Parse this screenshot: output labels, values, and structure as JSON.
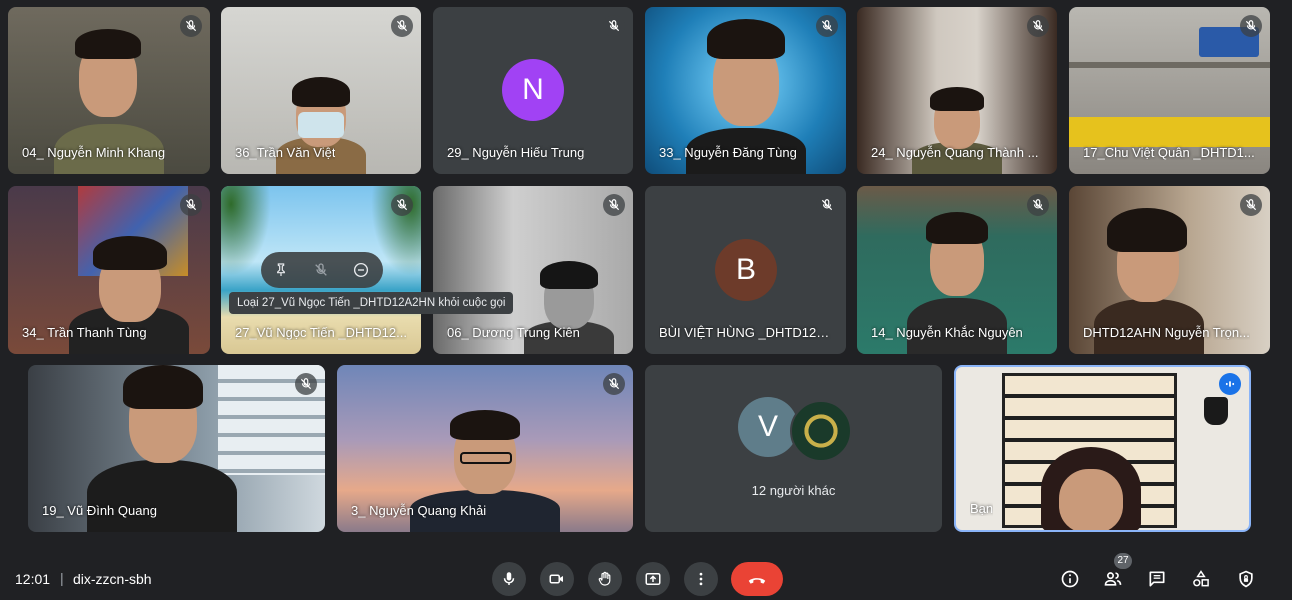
{
  "meeting": {
    "time": "12:01",
    "separator": "|",
    "code": "dix-zzcn-sbh"
  },
  "participants": [
    {
      "name": "04_ Nguyễn Minh Khang"
    },
    {
      "name": "36_Trần Văn Việt"
    },
    {
      "name": "29_ Nguyễn Hiếu Trung",
      "initial": "N",
      "avatar_color": "#a142f4"
    },
    {
      "name": "33_ Nguyễn Đăng Tùng"
    },
    {
      "name": "24_ Nguyễn Quang Thành ..."
    },
    {
      "name": "17_Chu Việt Quân _DHTD1..."
    },
    {
      "name": "34_ Trần Thanh Tùng"
    },
    {
      "name": "27_Vũ Ngọc Tiến _DHTD12..."
    },
    {
      "name": "06_ Dương Trung Kiên"
    },
    {
      "name": "BÙI VIỆT HÙNG _DHTD12A2...",
      "initial": "B",
      "avatar_color": "#6d3b2a"
    },
    {
      "name": "14_ Nguyễn Khắc Nguyên"
    },
    {
      "name": "DHTD12AHN Nguyễn Trọn..."
    },
    {
      "name": "19_ Vũ Đình Quang"
    },
    {
      "name": "3_ Nguyễn Quang Khải"
    },
    {
      "name": "12 người khác",
      "initial": "V",
      "avatar_color": "#5f7d8a"
    },
    {
      "name": "Bạn"
    }
  ],
  "tooltip": {
    "text": "Loại 27_Vũ Ngọc Tiến _DHTD12A2HN khỏi cuộc gọi"
  },
  "hover_actions": [
    "pin-icon",
    "mic-off-icon",
    "remove-icon"
  ],
  "participants_count": "27",
  "controls": [
    "mic-icon",
    "camera-icon",
    "raise-hand-icon",
    "present-icon",
    "more-icon",
    "end-call-icon"
  ],
  "right_icons": [
    "info-icon",
    "people-icon",
    "chat-icon",
    "activities-icon",
    "host-controls-icon"
  ],
  "colors": {
    "background": "#202124",
    "tile": "#3c4043",
    "end_call": "#ea4335",
    "active_speaker": "#8ab4f8"
  }
}
